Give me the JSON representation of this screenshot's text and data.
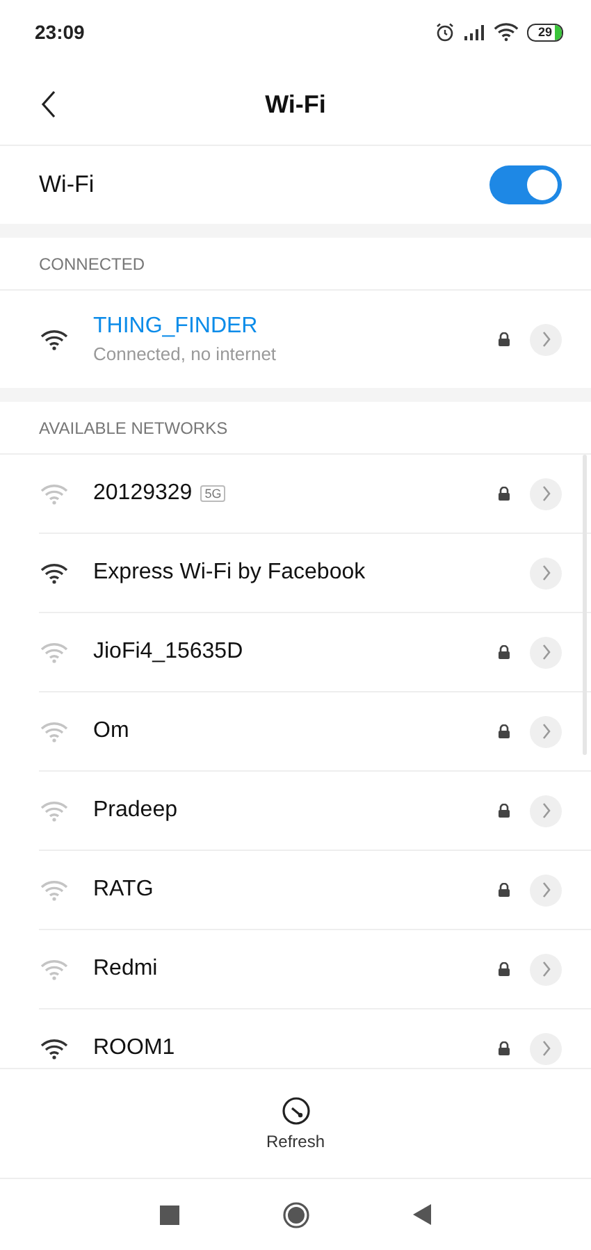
{
  "status_bar": {
    "time": "23:09",
    "battery": "29"
  },
  "header": {
    "title": "Wi-Fi"
  },
  "wifi_toggle": {
    "label": "Wi-Fi",
    "on": true
  },
  "connected": {
    "heading": "CONNECTED",
    "network": {
      "name": "THING_FINDER",
      "status": "Connected, no internet",
      "strong": true,
      "locked": true
    }
  },
  "available": {
    "heading": "AVAILABLE NETWORKS",
    "networks": [
      {
        "name": "20129329",
        "badge": "5G",
        "strong": false,
        "locked": true
      },
      {
        "name": "Express Wi-Fi by Facebook",
        "strong": true,
        "locked": false
      },
      {
        "name": "JioFi4_15635D",
        "strong": false,
        "locked": true
      },
      {
        "name": "Om",
        "strong": false,
        "locked": true
      },
      {
        "name": "Pradeep",
        "strong": false,
        "locked": true
      },
      {
        "name": "RATG",
        "strong": false,
        "locked": true
      },
      {
        "name": "Redmi",
        "strong": false,
        "locked": true
      },
      {
        "name": "ROOM1",
        "strong": true,
        "locked": true
      }
    ]
  },
  "refresh": {
    "label": "Refresh"
  }
}
